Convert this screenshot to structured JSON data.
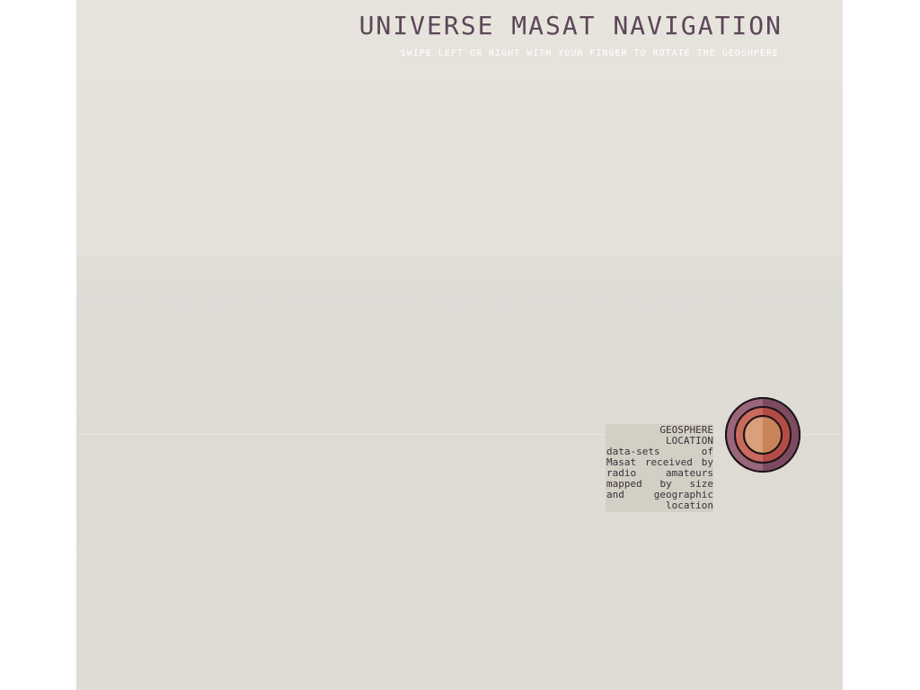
{
  "header": {
    "title": "UNIVERSE MASAT NAVIGATION",
    "subtitle": "SWIPE LEFT OR RIGHT WITH YOUR FINGER TO ROTATE THE GEOSHPERE"
  },
  "legend": {
    "heading": "GEOSPHERE LOCATION",
    "description": "data-sets of Masat received by radio amateurs mapped by size and geographic location"
  },
  "icon": {
    "name": "geosphere-icon",
    "colors": {
      "outer_ring": "#9a6679",
      "middle_ring": "#bf5a50",
      "inner_disc": "#cd8b62",
      "stroke": "#1e1418"
    }
  },
  "theme": {
    "background_top": "#e7e4dd",
    "background_bottom": "#dedcd5",
    "title_color": "#5c4658",
    "subtitle_color": "#ffffff",
    "legend_bg": "#d2cfc4"
  }
}
